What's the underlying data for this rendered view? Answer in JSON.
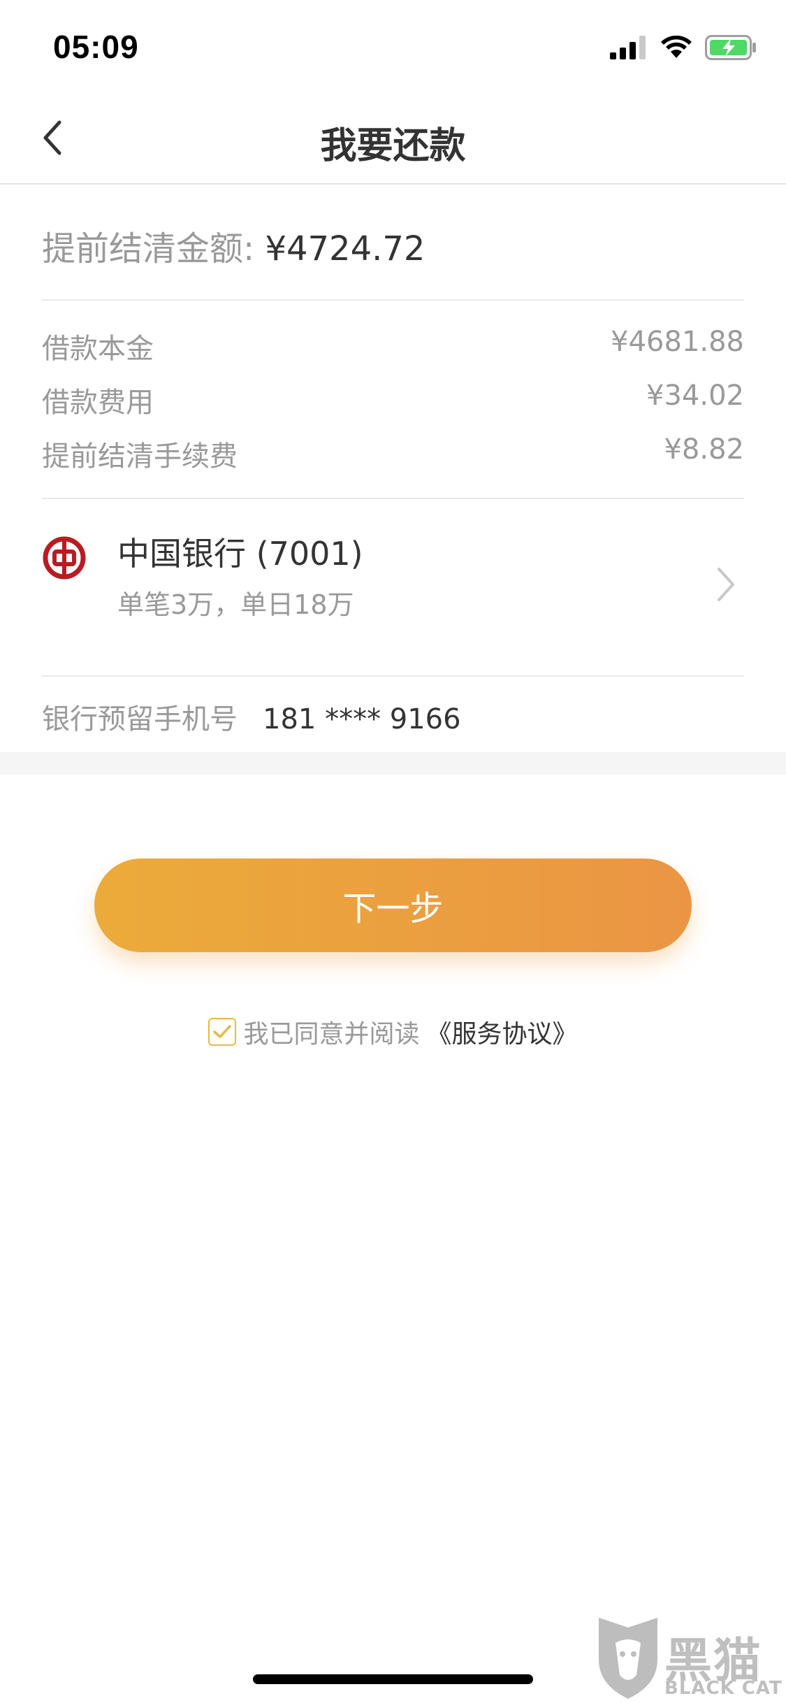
{
  "status_bar": {
    "time": "05:09",
    "icons": [
      "signal-icon",
      "wifi-icon",
      "battery-charging-icon"
    ]
  },
  "nav": {
    "title": "我要还款",
    "back_icon": "chevron-left-icon"
  },
  "settlement": {
    "label": "提前结清金额: ",
    "amount": "¥4724.72"
  },
  "details": [
    {
      "label": "借款本金",
      "value": "¥4681.88"
    },
    {
      "label": "借款费用",
      "value": "¥34.02"
    },
    {
      "label": "提前结清手续费",
      "value": "¥8.82"
    }
  ],
  "bank": {
    "name": "中国银行 (7001)",
    "limit": "单笔3万，单日18万",
    "logo_color": "#b81c22"
  },
  "phone": {
    "label": "银行预留手机号",
    "value": "181 **** 9166"
  },
  "actions": {
    "next_label": "下一步"
  },
  "agreement": {
    "checked": true,
    "text": "我已同意并阅读",
    "link": "《服务协议》"
  },
  "watermark": {
    "title": "黑猫",
    "subtitle": "BLACK CAT"
  },
  "colors": {
    "accent_start": "#ebab3a",
    "accent_end": "#eb9544",
    "text_primary": "#333333",
    "text_secondary": "#999999"
  }
}
